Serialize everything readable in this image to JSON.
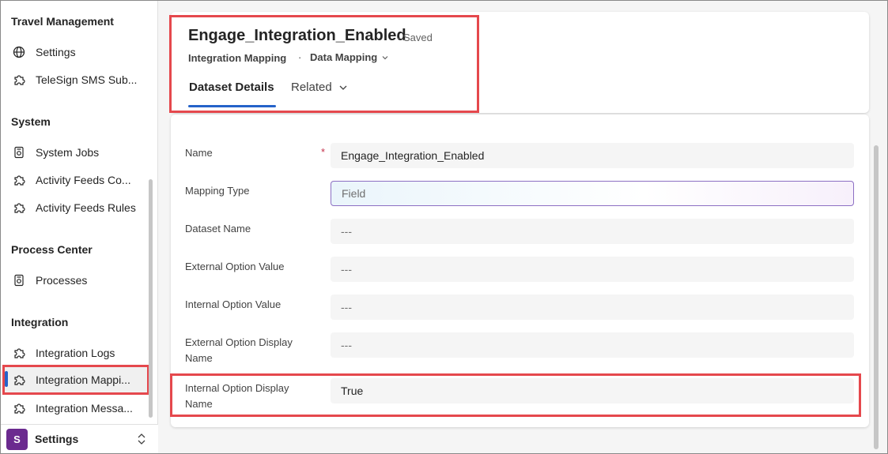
{
  "sidebar": {
    "groups": [
      {
        "title": "Travel Management",
        "items": [
          {
            "label": "Settings",
            "icon": "globe-icon"
          },
          {
            "label": "TeleSign SMS Sub...",
            "icon": "puzzle-icon"
          }
        ]
      },
      {
        "title": "System",
        "items": [
          {
            "label": "System Jobs",
            "icon": "gear-doc-icon"
          },
          {
            "label": "Activity Feeds Co...",
            "icon": "puzzle-icon"
          },
          {
            "label": "Activity Feeds Rules",
            "icon": "puzzle-icon"
          }
        ]
      },
      {
        "title": "Process Center",
        "items": [
          {
            "label": "Processes",
            "icon": "gear-doc-icon"
          }
        ]
      },
      {
        "title": "Integration",
        "items": [
          {
            "label": "Integration Logs",
            "icon": "puzzle-icon"
          },
          {
            "label": "Integration Mappi...",
            "icon": "puzzle-icon",
            "selected": true
          },
          {
            "label": "Integration Messa...",
            "icon": "puzzle-icon"
          }
        ]
      }
    ],
    "area": {
      "badge": "S",
      "label": "Settings"
    }
  },
  "record": {
    "title": "Engage_Integration_Enabled",
    "status": "- Saved",
    "entity": "Integration Mapping",
    "separator": "·",
    "form": "Data Mapping"
  },
  "tabs": {
    "active": "Dataset Details",
    "related": "Related"
  },
  "fields": {
    "name": {
      "label": "Name",
      "value": "Engage_Integration_Enabled",
      "required": "*"
    },
    "mapping_type": {
      "label": "Mapping Type",
      "placeholder": "Field"
    },
    "dataset_name": {
      "label": "Dataset Name",
      "value": "---"
    },
    "external_option_value": {
      "label": "External Option Value",
      "value": "---"
    },
    "internal_option_value": {
      "label": "Internal Option Value",
      "value": "---"
    },
    "external_option_display_name": {
      "label": "External Option Display Name",
      "value": "---"
    },
    "internal_option_display_name": {
      "label": "Internal Option Display Name",
      "value": "True"
    }
  },
  "colors": {
    "accent": "#2563c9",
    "highlight": "#e5484d",
    "area_badge": "#6b2a8f"
  }
}
